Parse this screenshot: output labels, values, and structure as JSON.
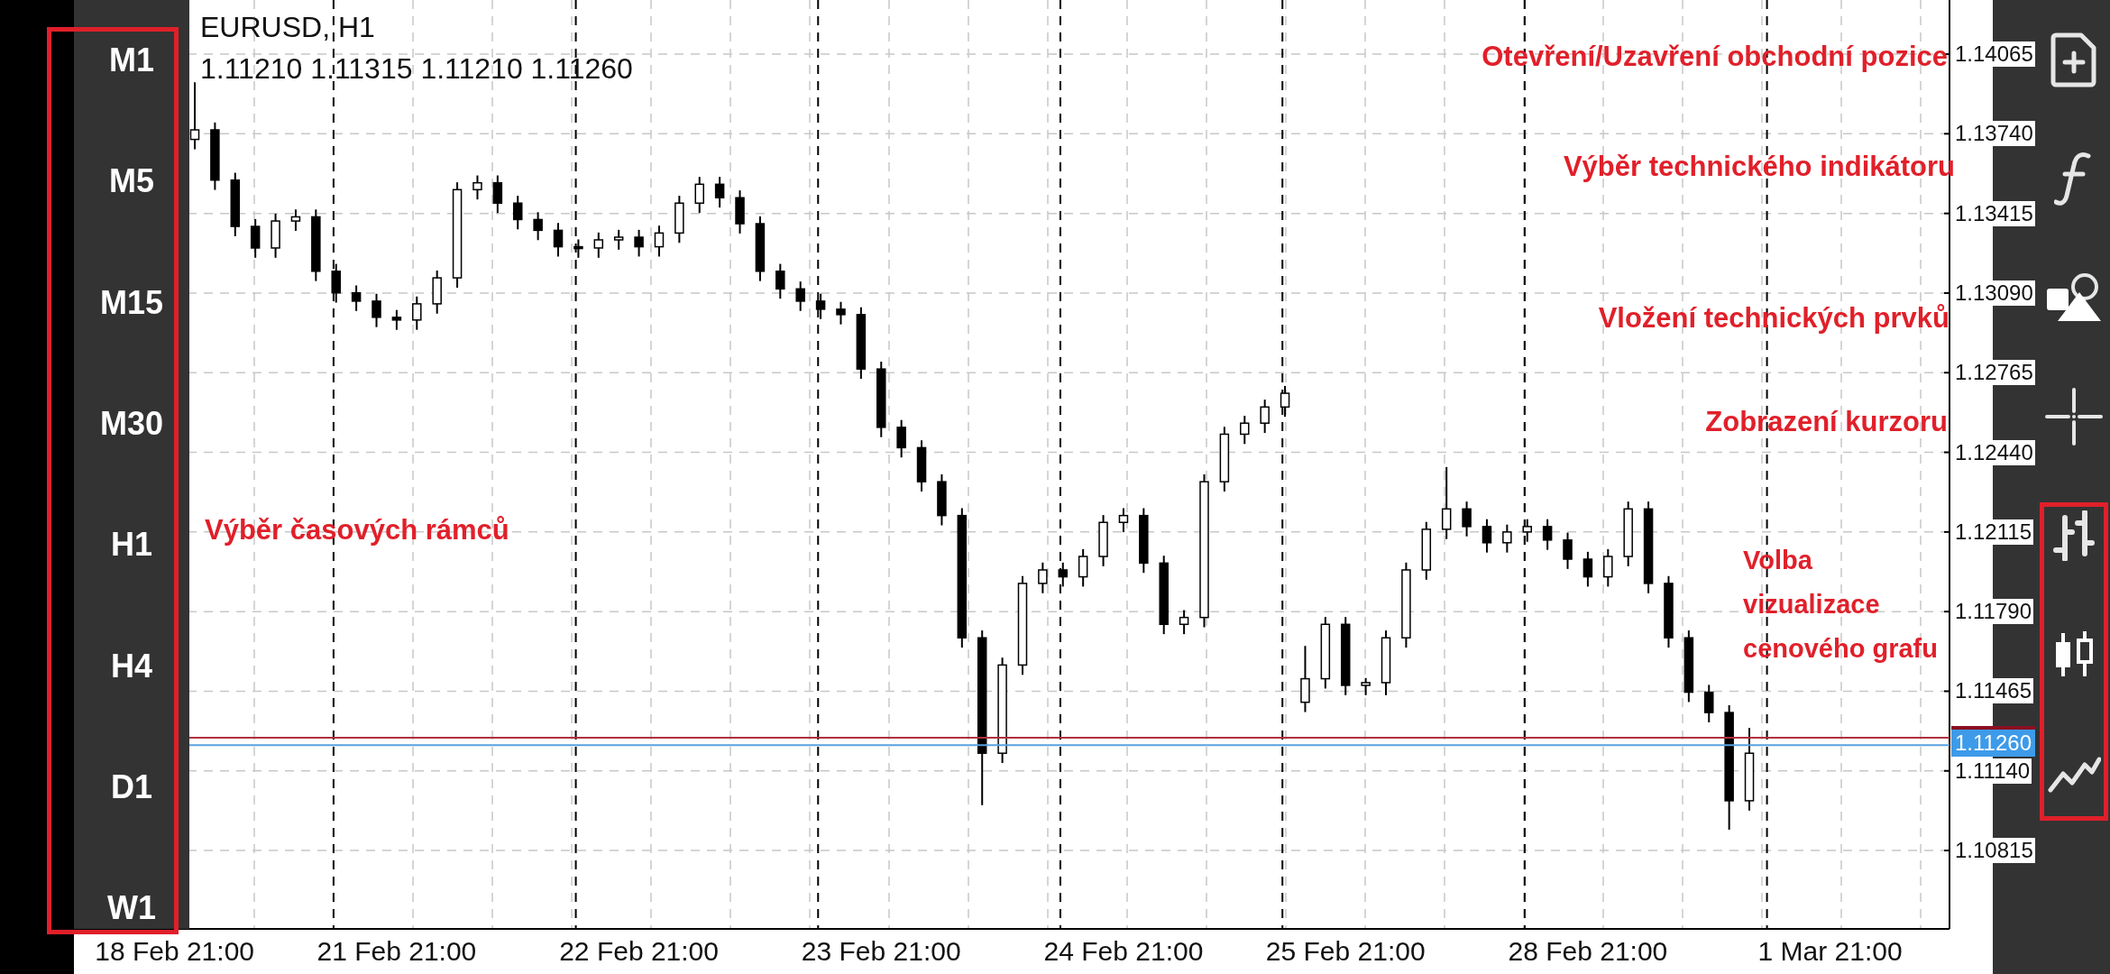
{
  "chart": {
    "symbol": "EURUSD, H1",
    "ohlc": "1.11210 1.11315 1.11210 1.11260",
    "current_price": "1.11260",
    "chart_data": {
      "type": "candlestick",
      "ylim": [
        1.10495,
        1.14286
      ],
      "categories": [
        null,
        "18 Feb 21:00",
        null,
        null,
        null,
        null,
        null,
        null,
        null,
        null,
        null,
        null,
        "21 Feb 21:00",
        null,
        null,
        null,
        null,
        null,
        null,
        null,
        null,
        null,
        null,
        null,
        "22 Feb 21:00",
        null,
        null,
        null,
        null,
        null,
        null,
        null,
        null,
        null,
        null,
        null,
        "23 Feb 21:00",
        null,
        null,
        null,
        null,
        null,
        null,
        null,
        null,
        null,
        null,
        null,
        "24 Feb 21:00",
        null,
        null,
        null,
        null,
        null,
        null,
        null,
        null,
        null,
        null,
        "25 Feb 21:00",
        null,
        null,
        null,
        null,
        null,
        null,
        null,
        null,
        null,
        null,
        null,
        "28 Feb 21:00",
        null,
        null,
        null,
        null,
        null,
        null,
        null,
        null,
        null,
        null,
        null,
        "1 Mar 21:00"
      ],
      "ohlc": [
        null,
        null,
        [
          1.13717,
          1.1395,
          1.13677,
          1.13756
        ],
        [
          1.13756,
          1.13786,
          1.13511,
          1.13551
        ],
        [
          1.13551,
          1.13581,
          1.13322,
          1.13362
        ],
        [
          1.13362,
          1.13392,
          1.13234,
          1.13274
        ],
        [
          1.13274,
          1.13414,
          1.13234,
          1.13384
        ],
        [
          1.13384,
          1.13431,
          1.13344,
          1.13401
        ],
        [
          1.13401,
          1.13431,
          1.13139,
          1.13179
        ],
        [
          1.13179,
          1.13209,
          1.13051,
          1.13091
        ],
        [
          1.13091,
          1.13121,
          1.13017,
          1.13057
        ],
        [
          1.13057,
          1.13087,
          1.12951,
          1.12991
        ],
        [
          1.12991,
          1.13021,
          1.1294,
          1.1298
        ],
        [
          1.1298,
          1.13076,
          1.1294,
          1.13046
        ],
        [
          1.13046,
          1.13182,
          1.13006,
          1.13152
        ],
        [
          1.13152,
          1.13542,
          1.13112,
          1.13512
        ],
        [
          1.13512,
          1.1357,
          1.13472,
          1.1354
        ],
        [
          1.1354,
          1.1357,
          1.13417,
          1.13457
        ],
        [
          1.13457,
          1.13487,
          1.1335,
          1.1339
        ],
        [
          1.1339,
          1.1342,
          1.13306,
          1.13346
        ],
        [
          1.13346,
          1.13376,
          1.13239,
          1.13279
        ],
        [
          1.13279,
          1.13309,
          1.13234,
          1.13274
        ],
        [
          1.13274,
          1.13337,
          1.13234,
          1.13307
        ],
        [
          1.13307,
          1.13348,
          1.13267,
          1.13318
        ],
        [
          1.13318,
          1.13348,
          1.13239,
          1.13279
        ],
        [
          1.13279,
          1.13365,
          1.13239,
          1.13335
        ],
        [
          1.13335,
          1.13487,
          1.13295,
          1.13457
        ],
        [
          1.13457,
          1.13564,
          1.13417,
          1.13534
        ],
        [
          1.13534,
          1.13564,
          1.13439,
          1.13479
        ],
        [
          1.13479,
          1.13509,
          1.13333,
          1.13373
        ],
        [
          1.13373,
          1.13403,
          1.13139,
          1.13179
        ],
        [
          1.13179,
          1.13209,
          1.13067,
          1.13107
        ],
        [
          1.13107,
          1.13137,
          1.13017,
          1.13057
        ],
        [
          1.13057,
          1.13087,
          1.12984,
          1.13024
        ],
        [
          1.13024,
          1.13054,
          1.12962,
          1.13002
        ],
        [
          1.13002,
          1.13032,
          1.1274,
          1.1278
        ],
        [
          1.1278,
          1.1281,
          1.12502,
          1.12542
        ],
        [
          1.12542,
          1.12572,
          1.12419,
          1.12459
        ],
        [
          1.12459,
          1.12489,
          1.1228,
          1.1232
        ],
        [
          1.1232,
          1.1235,
          1.12142,
          1.12182
        ],
        [
          1.12182,
          1.12212,
          1.11643,
          1.11683
        ],
        [
          1.11683,
          1.11713,
          1.11,
          1.11212
        ],
        [
          1.11212,
          1.11602,
          1.11172,
          1.11572
        ],
        [
          1.11572,
          1.11935,
          1.11532,
          1.11905
        ],
        [
          1.11905,
          1.1199,
          1.11865,
          1.1196
        ],
        [
          1.1196,
          1.1199,
          1.11892,
          1.11932
        ],
        [
          1.11932,
          1.12045,
          1.11892,
          1.12015
        ],
        [
          1.12015,
          1.12184,
          1.11975,
          1.12154
        ],
        [
          1.12154,
          1.12212,
          1.12114,
          1.12182
        ],
        [
          1.12182,
          1.12212,
          1.11948,
          1.11988
        ],
        [
          1.11988,
          1.12018,
          1.11698,
          1.11738
        ],
        [
          1.11738,
          1.11796,
          1.11698,
          1.11766
        ],
        [
          1.11766,
          1.1235,
          1.11726,
          1.1232
        ],
        [
          1.1232,
          1.12544,
          1.1228,
          1.12514
        ],
        [
          1.12514,
          1.12589,
          1.12474,
          1.12559
        ],
        [
          1.12559,
          1.12655,
          1.12519,
          1.12625
        ],
        [
          1.12625,
          1.12711,
          1.12585,
          1.12681
        ],
        [
          1.1142,
          1.1165,
          1.1138,
          1.11516
        ],
        [
          1.11516,
          1.11768,
          1.11476,
          1.11738
        ],
        [
          1.11738,
          1.11768,
          1.11449,
          1.11489
        ],
        [
          1.11489,
          1.11519,
          1.11449,
          1.115
        ],
        [
          1.115,
          1.11713,
          1.11449,
          1.11683
        ],
        [
          1.11683,
          1.1199,
          1.11643,
          1.1196
        ],
        [
          1.1196,
          1.12156,
          1.1192,
          1.12126
        ],
        [
          1.12126,
          1.1238,
          1.12086,
          1.12209
        ],
        [
          1.12209,
          1.12239,
          1.12097,
          1.12137
        ],
        [
          1.12137,
          1.12167,
          1.12031,
          1.12071
        ],
        [
          1.12071,
          1.12145,
          1.12031,
          1.12115
        ],
        [
          1.12115,
          1.12167,
          1.12075,
          1.12137
        ],
        [
          1.12137,
          1.12167,
          1.12042,
          1.12082
        ],
        [
          1.12082,
          1.12112,
          1.11964,
          1.12004
        ],
        [
          1.12004,
          1.12034,
          1.11892,
          1.11932
        ],
        [
          1.11932,
          1.12045,
          1.11892,
          1.12015
        ],
        [
          1.12015,
          1.12239,
          1.11975,
          1.12209
        ],
        [
          1.12209,
          1.12239,
          1.11865,
          1.11905
        ],
        [
          1.11905,
          1.11935,
          1.11643,
          1.11683
        ],
        [
          1.11683,
          1.11713,
          1.11421,
          1.11461
        ],
        [
          1.11461,
          1.11491,
          1.11338,
          1.11378
        ],
        [
          1.11378,
          1.11408,
          1.109,
          1.11018
        ],
        [
          1.11018,
          1.11315,
          1.10978,
          1.11212
        ],
        null,
        null,
        null,
        null
      ],
      "yticks": [
        {
          "value": 1.14065,
          "label": "1.14065"
        },
        {
          "value": 1.1374,
          "label": "1.13740"
        },
        {
          "value": 1.13415,
          "label": "1.13415"
        },
        {
          "value": 1.1309,
          "label": "1.13090"
        },
        {
          "value": 1.12765,
          "label": "1.12765"
        },
        {
          "value": 1.1244,
          "label": "1.12440"
        },
        {
          "value": 1.12115,
          "label": "1.12115"
        },
        {
          "value": 1.1179,
          "label": "1.11790"
        },
        {
          "value": 1.11465,
          "label": "1.11465"
        },
        {
          "value": 1.1114,
          "label": "1.11140"
        },
        {
          "value": 1.10815,
          "label": "1.10815"
        }
      ],
      "grid": true,
      "ref_lines": [
        {
          "axis": "y",
          "value": 1.11275,
          "color": "#b03040"
        },
        {
          "axis": "y",
          "value": 1.11245,
          "color": "#5aa0e0"
        }
      ]
    }
  },
  "timeframes": [
    "M1",
    "M5",
    "M15",
    "M30",
    "H1",
    "H4",
    "D1",
    "W1"
  ],
  "annotations": [
    {
      "text": "Otevření/Uzavření obchodní pozice"
    },
    {
      "text": "Výběr technického indikátoru"
    },
    {
      "text": "Vložení technických prvků"
    },
    {
      "text": "Zobrazení kurzoru"
    },
    {
      "text": "Výběr časových rámců"
    },
    {
      "text": "Volba vizualizace cenového grafu"
    }
  ]
}
